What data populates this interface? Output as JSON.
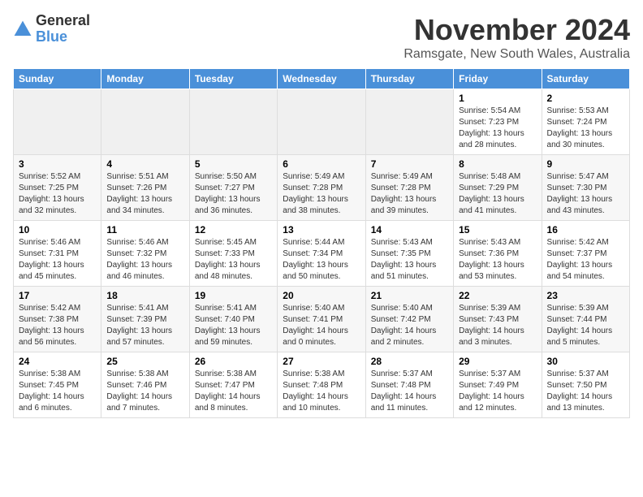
{
  "logo": {
    "general": "General",
    "blue": "Blue"
  },
  "title": "November 2024",
  "location": "Ramsgate, New South Wales, Australia",
  "days_of_week": [
    "Sunday",
    "Monday",
    "Tuesday",
    "Wednesday",
    "Thursday",
    "Friday",
    "Saturday"
  ],
  "weeks": [
    [
      {
        "day": "",
        "info": ""
      },
      {
        "day": "",
        "info": ""
      },
      {
        "day": "",
        "info": ""
      },
      {
        "day": "",
        "info": ""
      },
      {
        "day": "",
        "info": ""
      },
      {
        "day": "1",
        "info": "Sunrise: 5:54 AM\nSunset: 7:23 PM\nDaylight: 13 hours\nand 28 minutes."
      },
      {
        "day": "2",
        "info": "Sunrise: 5:53 AM\nSunset: 7:24 PM\nDaylight: 13 hours\nand 30 minutes."
      }
    ],
    [
      {
        "day": "3",
        "info": "Sunrise: 5:52 AM\nSunset: 7:25 PM\nDaylight: 13 hours\nand 32 minutes."
      },
      {
        "day": "4",
        "info": "Sunrise: 5:51 AM\nSunset: 7:26 PM\nDaylight: 13 hours\nand 34 minutes."
      },
      {
        "day": "5",
        "info": "Sunrise: 5:50 AM\nSunset: 7:27 PM\nDaylight: 13 hours\nand 36 minutes."
      },
      {
        "day": "6",
        "info": "Sunrise: 5:49 AM\nSunset: 7:28 PM\nDaylight: 13 hours\nand 38 minutes."
      },
      {
        "day": "7",
        "info": "Sunrise: 5:49 AM\nSunset: 7:28 PM\nDaylight: 13 hours\nand 39 minutes."
      },
      {
        "day": "8",
        "info": "Sunrise: 5:48 AM\nSunset: 7:29 PM\nDaylight: 13 hours\nand 41 minutes."
      },
      {
        "day": "9",
        "info": "Sunrise: 5:47 AM\nSunset: 7:30 PM\nDaylight: 13 hours\nand 43 minutes."
      }
    ],
    [
      {
        "day": "10",
        "info": "Sunrise: 5:46 AM\nSunset: 7:31 PM\nDaylight: 13 hours\nand 45 minutes."
      },
      {
        "day": "11",
        "info": "Sunrise: 5:46 AM\nSunset: 7:32 PM\nDaylight: 13 hours\nand 46 minutes."
      },
      {
        "day": "12",
        "info": "Sunrise: 5:45 AM\nSunset: 7:33 PM\nDaylight: 13 hours\nand 48 minutes."
      },
      {
        "day": "13",
        "info": "Sunrise: 5:44 AM\nSunset: 7:34 PM\nDaylight: 13 hours\nand 50 minutes."
      },
      {
        "day": "14",
        "info": "Sunrise: 5:43 AM\nSunset: 7:35 PM\nDaylight: 13 hours\nand 51 minutes."
      },
      {
        "day": "15",
        "info": "Sunrise: 5:43 AM\nSunset: 7:36 PM\nDaylight: 13 hours\nand 53 minutes."
      },
      {
        "day": "16",
        "info": "Sunrise: 5:42 AM\nSunset: 7:37 PM\nDaylight: 13 hours\nand 54 minutes."
      }
    ],
    [
      {
        "day": "17",
        "info": "Sunrise: 5:42 AM\nSunset: 7:38 PM\nDaylight: 13 hours\nand 56 minutes."
      },
      {
        "day": "18",
        "info": "Sunrise: 5:41 AM\nSunset: 7:39 PM\nDaylight: 13 hours\nand 57 minutes."
      },
      {
        "day": "19",
        "info": "Sunrise: 5:41 AM\nSunset: 7:40 PM\nDaylight: 13 hours\nand 59 minutes."
      },
      {
        "day": "20",
        "info": "Sunrise: 5:40 AM\nSunset: 7:41 PM\nDaylight: 14 hours\nand 0 minutes."
      },
      {
        "day": "21",
        "info": "Sunrise: 5:40 AM\nSunset: 7:42 PM\nDaylight: 14 hours\nand 2 minutes."
      },
      {
        "day": "22",
        "info": "Sunrise: 5:39 AM\nSunset: 7:43 PM\nDaylight: 14 hours\nand 3 minutes."
      },
      {
        "day": "23",
        "info": "Sunrise: 5:39 AM\nSunset: 7:44 PM\nDaylight: 14 hours\nand 5 minutes."
      }
    ],
    [
      {
        "day": "24",
        "info": "Sunrise: 5:38 AM\nSunset: 7:45 PM\nDaylight: 14 hours\nand 6 minutes."
      },
      {
        "day": "25",
        "info": "Sunrise: 5:38 AM\nSunset: 7:46 PM\nDaylight: 14 hours\nand 7 minutes."
      },
      {
        "day": "26",
        "info": "Sunrise: 5:38 AM\nSunset: 7:47 PM\nDaylight: 14 hours\nand 8 minutes."
      },
      {
        "day": "27",
        "info": "Sunrise: 5:38 AM\nSunset: 7:48 PM\nDaylight: 14 hours\nand 10 minutes."
      },
      {
        "day": "28",
        "info": "Sunrise: 5:37 AM\nSunset: 7:48 PM\nDaylight: 14 hours\nand 11 minutes."
      },
      {
        "day": "29",
        "info": "Sunrise: 5:37 AM\nSunset: 7:49 PM\nDaylight: 14 hours\nand 12 minutes."
      },
      {
        "day": "30",
        "info": "Sunrise: 5:37 AM\nSunset: 7:50 PM\nDaylight: 14 hours\nand 13 minutes."
      }
    ]
  ]
}
